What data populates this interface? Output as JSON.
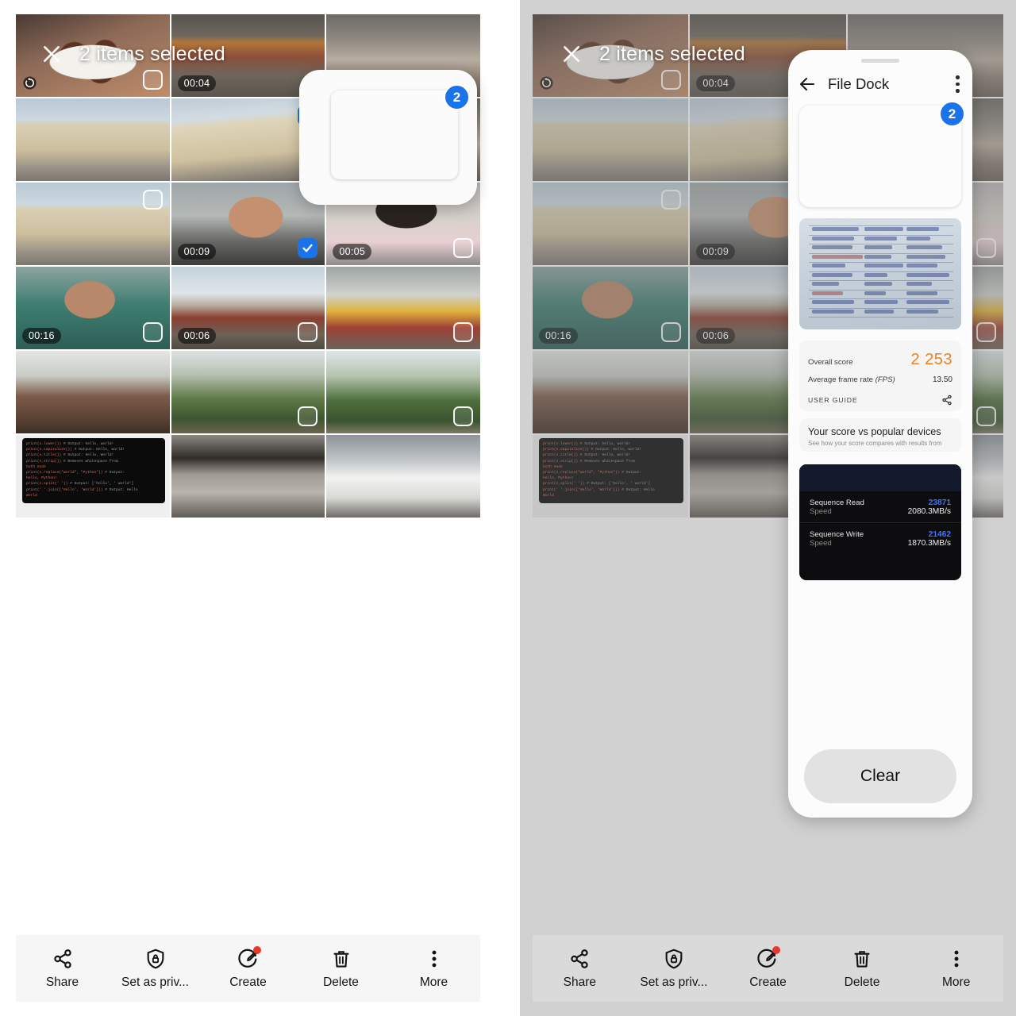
{
  "selection_header": {
    "close_icon": "close-icon",
    "title": "2 items selected"
  },
  "drag_preview": {
    "badge_count": "2"
  },
  "file_dock": {
    "back_icon": "arrow-left-icon",
    "title": "File Dock",
    "overflow_icon": "more-vertical-icon",
    "badge_count": "2",
    "benchmark": {
      "overall_label": "Overall score",
      "overall_value": "2 253",
      "fps_label": "Average frame rate ",
      "fps_label_em": "(FPS)",
      "fps_value": "13.50",
      "guide_label": "USER GUIDE",
      "share_icon": "share-icon",
      "compare_title": "Your score vs popular devices",
      "compare_sub": "See how your score compares with results from"
    },
    "storage": [
      {
        "label": "Sequence Read",
        "score": "23871",
        "speed_label": "Speed",
        "speed": "2080.3MB/s"
      },
      {
        "label": "Sequence Write",
        "score": "21462",
        "speed_label": "Speed",
        "speed": "1870.3MB/s"
      }
    ],
    "clear_label": "Clear"
  },
  "toolbar": {
    "items": [
      {
        "label": "Share",
        "icon": "share-icon",
        "badge": false
      },
      {
        "label": "Set as priv...",
        "icon": "shield-lock-icon",
        "badge": false
      },
      {
        "label": "Create",
        "icon": "pencil-circle-icon",
        "badge": true
      },
      {
        "label": "Delete",
        "icon": "trash-icon",
        "badge": false
      },
      {
        "label": "More",
        "icon": "more-vertical-icon",
        "badge": false
      }
    ]
  },
  "grid": {
    "tiles": [
      {
        "kind": "chai",
        "duration": "",
        "state": "unselected",
        "motion": true
      },
      {
        "kind": "cafe",
        "duration": "00:04",
        "state": "none"
      },
      {
        "kind": "street",
        "duration": "",
        "state": "none"
      },
      {
        "kind": "bldg",
        "duration": "",
        "state": "none"
      },
      {
        "kind": "bldg2",
        "duration": "",
        "state": "selected"
      },
      {
        "kind": "street",
        "duration": "",
        "state": "none"
      },
      {
        "kind": "bldg",
        "duration": "",
        "state": "unselected"
      },
      {
        "kind": "selfie",
        "duration": "00:09",
        "state": "selected"
      },
      {
        "kind": "back",
        "duration": "00:05",
        "state": "unselected"
      },
      {
        "kind": "greenman",
        "duration": "00:16",
        "state": "unselected"
      },
      {
        "kind": "bridge",
        "duration": "00:06",
        "state": "unselected"
      },
      {
        "kind": "truck",
        "duration": "",
        "state": "unselected"
      },
      {
        "kind": "tree1",
        "duration": "",
        "state": "none"
      },
      {
        "kind": "tree2",
        "duration": "",
        "state": "unselected"
      },
      {
        "kind": "tree3",
        "duration": "",
        "state": "unselected"
      },
      {
        "kind": "code",
        "duration": "",
        "state": "none"
      },
      {
        "kind": "road",
        "duration": "",
        "state": "none"
      },
      {
        "kind": "car",
        "duration": "",
        "state": "none"
      }
    ],
    "code_lines": [
      "print(s.lower())       # Output: hello, world!",
      "print(s.capitalize())  # Output: Hello, world!",
      "print(s.title())       # Output: Hello, World!",
      "print(s.strip())       # Removes whitespace from",
      "both ends",
      "print(s.replace(\"world\", \"Python\"))  # Output:",
      "hello, Python!",
      "print(s.split(' '))    # Output: ['hello', ' world']",
      "print(' '.join(['Hello', 'World']))  # Output: Hello",
      "World"
    ]
  },
  "colors": {
    "accent_blue": "#1a73e8",
    "score_orange": "#ee8022",
    "badge_red": "#e8382b",
    "link_blue": "#3f74ff"
  }
}
